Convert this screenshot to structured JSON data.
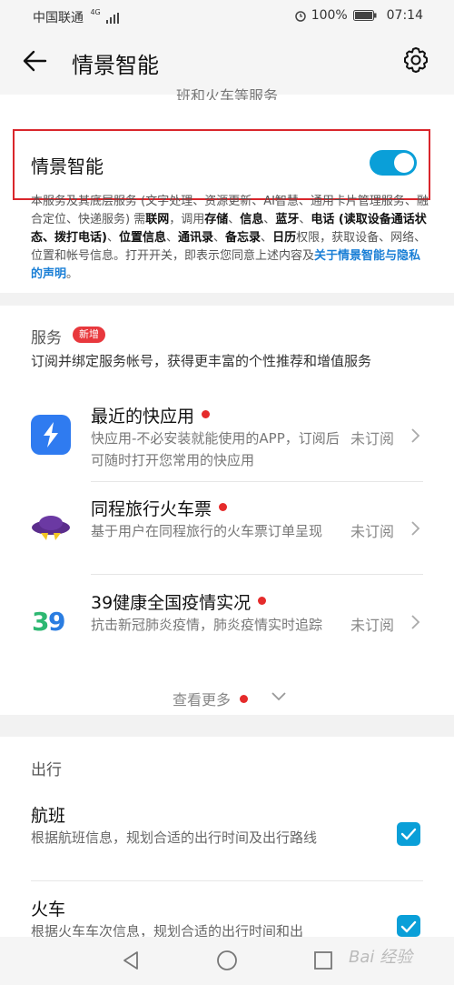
{
  "status_bar": {
    "carrier": "中国联通",
    "network": "4G",
    "battery": "100%",
    "time": "07:14"
  },
  "app_bar": {
    "title": "情景智能"
  },
  "top_card": {
    "cut_text": "班和火车等服务",
    "toggle_label": "情景智能",
    "toggle_on": true,
    "notice_segments": [
      {
        "t": "本服务及其底层服务 (文字处理、资源更新、AI智慧、通用卡片管理服务、融合定位、快递服务) 需",
        "s": "n"
      },
      {
        "t": "联网",
        "s": "b"
      },
      {
        "t": "，调用",
        "s": "n"
      },
      {
        "t": "存储",
        "s": "b"
      },
      {
        "t": "、",
        "s": "n"
      },
      {
        "t": "信息",
        "s": "b"
      },
      {
        "t": "、",
        "s": "n"
      },
      {
        "t": "蓝牙",
        "s": "b"
      },
      {
        "t": "、",
        "s": "n"
      },
      {
        "t": "电话 (读取设备通话状态、拨打电话)",
        "s": "b"
      },
      {
        "t": "、",
        "s": "n"
      },
      {
        "t": "位置信息",
        "s": "b"
      },
      {
        "t": "、",
        "s": "n"
      },
      {
        "t": "通讯录",
        "s": "b"
      },
      {
        "t": "、",
        "s": "n"
      },
      {
        "t": "备忘录",
        "s": "b"
      },
      {
        "t": "、",
        "s": "n"
      },
      {
        "t": "日历",
        "s": "b"
      },
      {
        "t": "权限，获取设备、网络、位置和帐号信息。打开开关，即表示您同意上述内容及",
        "s": "n"
      },
      {
        "t": "关于情景智能与隐私的声明",
        "s": "l"
      },
      {
        "t": "。",
        "s": "n"
      }
    ]
  },
  "services": {
    "title": "服务",
    "badge": "新增",
    "description": "订阅并绑定服务帐号，获得更丰富的个性推荐和增值服务",
    "items": [
      {
        "name": "最近的快应用",
        "desc": "快应用-不必安装就能使用的APP，订阅后可随时打开您常用的快应用",
        "status": "未订阅",
        "icon": "quick-app-icon"
      },
      {
        "name": "同程旅行火车票",
        "desc": "基于用户在同程旅行的火车票订单呈现",
        "status": "未订阅",
        "icon": "tongcheng-travel-icon"
      },
      {
        "name": "39健康全国疫情实况",
        "desc": "抗击新冠肺炎疫情，肺炎疫情实时追踪",
        "status": "未订阅",
        "icon": "health-39-icon"
      }
    ],
    "see_more": "查看更多"
  },
  "travel": {
    "title": "出行",
    "items": [
      {
        "name": "航班",
        "desc": "根据航班信息，规划合适的出行时间及出行路线",
        "checked": true
      },
      {
        "name": "火车",
        "desc": "根据火车车次信息，规划合适的出行时间和出",
        "checked": true
      }
    ]
  },
  "watermark": "Bai 经验",
  "colors": {
    "accent": "#0a9fd8",
    "badge_red": "#e8383d",
    "highlight_box": "#d9262c",
    "link": "#1a7fd6"
  }
}
